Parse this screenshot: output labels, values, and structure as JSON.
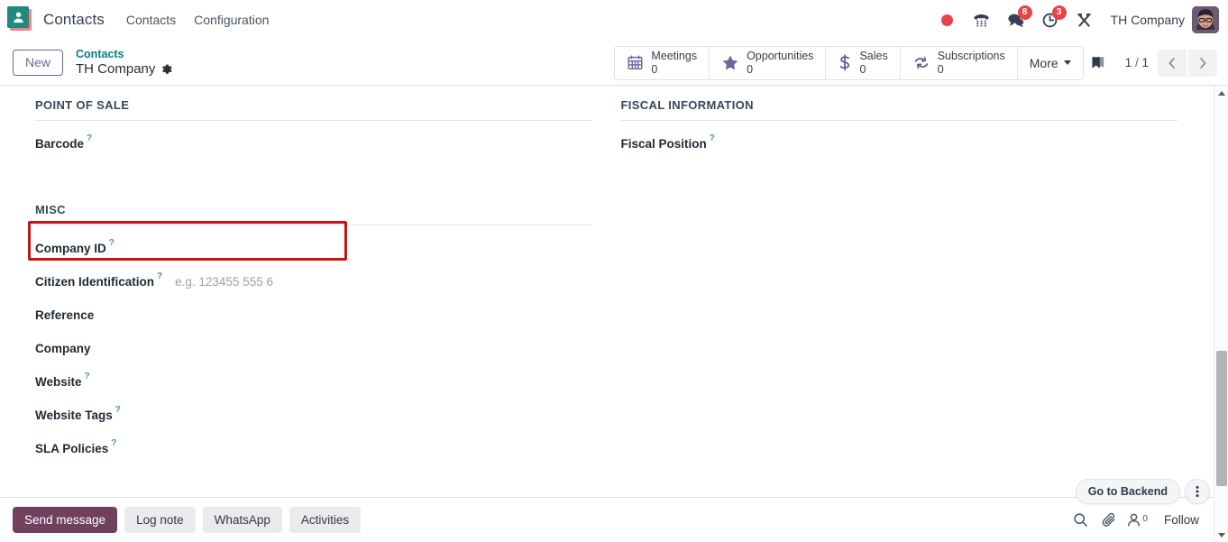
{
  "navbar": {
    "app_icon": "contacts-app-icon",
    "brand": "Contacts",
    "menus": [
      {
        "label": "Contacts",
        "name": "menu-contacts"
      },
      {
        "label": "Configuration",
        "name": "menu-configuration"
      }
    ],
    "tray": {
      "recording_icon": "record-dot-icon",
      "voip_icon": "phone-dialpad-icon",
      "messages_icon": "chat-bubble-icon",
      "messages_badge": "8",
      "activities_icon": "clock-icon",
      "activities_badge": "3",
      "tools_icon": "wrench-screwdriver-icon",
      "user_name": "TH Company",
      "avatar": "user-avatar"
    }
  },
  "control_panel": {
    "new_label": "New",
    "breadcrumb_parent": "Contacts",
    "breadcrumb_current": "TH Company",
    "gear_icon": "gear-icon",
    "stat_buttons": [
      {
        "label": "Meetings",
        "value": "0",
        "icon": "calendar-icon",
        "name": "stat-button-meetings"
      },
      {
        "label": "Opportunities",
        "value": "0",
        "icon": "star-icon",
        "name": "stat-button-opportunities"
      },
      {
        "label": "Sales",
        "value": "0",
        "icon": "dollar-icon",
        "name": "stat-button-sales"
      },
      {
        "label": "Subscriptions",
        "value": "0",
        "icon": "refresh-icon",
        "name": "stat-button-subscriptions"
      }
    ],
    "more_label": "More",
    "ribbon_icon": "bookmark-ribbon-icon",
    "pager_current": "1",
    "pager_separator": "/",
    "pager_total": "1",
    "prev_icon": "chevron-left-icon",
    "next_icon": "chevron-right-icon"
  },
  "form": {
    "left": {
      "pos_group_title": "POINT OF SALE",
      "pos_fields": [
        {
          "label": "Barcode",
          "tip": "?",
          "value": "",
          "placeholder": "",
          "name": "field-barcode"
        }
      ],
      "misc_group_title": "MISC",
      "misc_fields": [
        {
          "label": "Company ID",
          "tip": "?",
          "value": "",
          "placeholder": "",
          "name": "field-company-id",
          "highlighted": true
        },
        {
          "label": "Citizen Identification",
          "tip": "?",
          "value": "",
          "placeholder": "e.g. 123455 555 6",
          "name": "field-citizen-identification"
        },
        {
          "label": "Reference",
          "tip": "",
          "value": "",
          "placeholder": "",
          "name": "field-reference"
        },
        {
          "label": "Company",
          "tip": "",
          "value": "",
          "placeholder": "",
          "name": "field-company"
        },
        {
          "label": "Website",
          "tip": "?",
          "value": "",
          "placeholder": "",
          "name": "field-website"
        },
        {
          "label": "Website Tags",
          "tip": "?",
          "value": "",
          "placeholder": "",
          "name": "field-website-tags"
        },
        {
          "label": "SLA Policies",
          "tip": "?",
          "value": "",
          "placeholder": "",
          "name": "field-sla-policies"
        }
      ]
    },
    "right": {
      "fiscal_group_title": "FISCAL INFORMATION",
      "fiscal_fields": [
        {
          "label": "Fiscal Position",
          "tip": "?",
          "value": "",
          "placeholder": "",
          "name": "field-fiscal-position"
        }
      ]
    },
    "annotation_color": "#cc1111"
  },
  "backend_widget": {
    "label": "Go to Backend",
    "menu_icon": "kebab-menu-icon"
  },
  "chatter": {
    "buttons": [
      {
        "label": "Send message",
        "active": true,
        "name": "send-message-button"
      },
      {
        "label": "Log note",
        "active": false,
        "name": "log-note-button"
      },
      {
        "label": "WhatsApp",
        "active": false,
        "name": "whatsapp-button"
      },
      {
        "label": "Activities",
        "active": false,
        "name": "activities-button"
      }
    ],
    "search_icon": "search-icon",
    "attachment_icon": "paperclip-icon",
    "followers_icon": "person-icon",
    "followers_count": "0",
    "follow_label": "Follow"
  }
}
